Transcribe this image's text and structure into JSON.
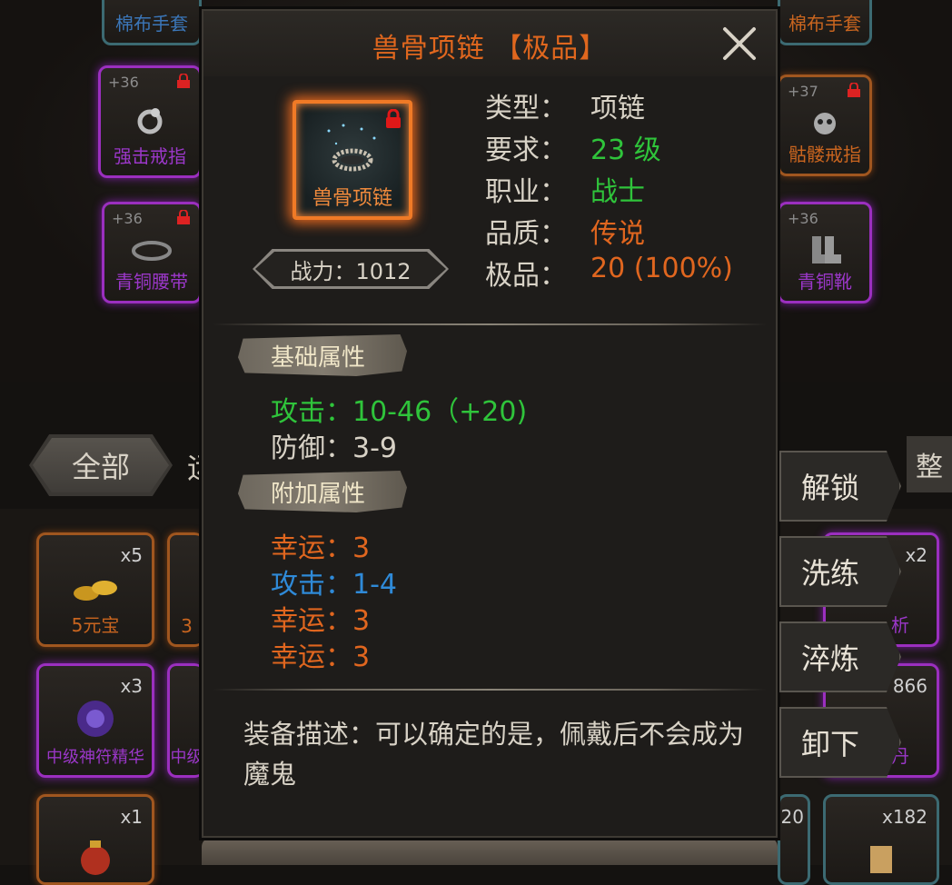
{
  "popup": {
    "title": "兽骨项链 【极品】",
    "item_label": "兽骨项链",
    "power": "战力：1012",
    "info": [
      {
        "label": "类型：",
        "value": "项链",
        "color": "#d8d2c6"
      },
      {
        "label": "要求：",
        "value": "23 级",
        "color": "#2fc43b"
      },
      {
        "label": "职业：",
        "value": "战士",
        "color": "#2fc43b"
      },
      {
        "label": "品质：",
        "value": "传说",
        "color": "#e0661f"
      },
      {
        "label": "极品：",
        "value": "20 (100%)",
        "color": "#e0661f"
      }
    ],
    "base_title": "基础属性",
    "base_stats": [
      {
        "text": "攻击：10-46（+20)",
        "color": "#2fc43b"
      },
      {
        "text": "防御：3-9",
        "color": "#d8d2c6"
      }
    ],
    "extra_title": "附加属性",
    "extra_stats": [
      {
        "text": "幸运：3",
        "color": "#e0661f"
      },
      {
        "text": "攻击：1-4",
        "color": "#2f8ad8"
      },
      {
        "text": "幸运：3",
        "color": "#e0661f"
      },
      {
        "text": "幸运：3",
        "color": "#e0661f"
      }
    ],
    "description": "装备描述：可以确定的是，佩戴后不会成为魔鬼"
  },
  "actions": [
    "解锁",
    "洗练",
    "淬炼",
    "卸下"
  ],
  "background": {
    "tab_all": "全部",
    "tab_next": "运",
    "sort": "整",
    "slots": {
      "top_left": "棉布手套",
      "top_right": "棉布手套",
      "ring_left": "强击戒指",
      "ring_left_plus": "+36",
      "ring_right": "骷髅戒指",
      "ring_right_plus": "+37",
      "belt": "青铜腰带",
      "belt_plus": "+36",
      "boots": "青铜靴",
      "boots_plus": "+36",
      "yuanbao": "5元宝",
      "yuanbao_qty": "x5",
      "rune": "中级神符精华",
      "rune_qty": "x3",
      "bag_qty": "x1",
      "mid_partial_1": "3",
      "mid_partial_2": "中级",
      "right_qty_1": "x2",
      "right_name_1": "析",
      "right_qty_2": "866",
      "right_name_2": "丹",
      "right_qty_3": "20",
      "right_qty_4": "x182"
    }
  }
}
